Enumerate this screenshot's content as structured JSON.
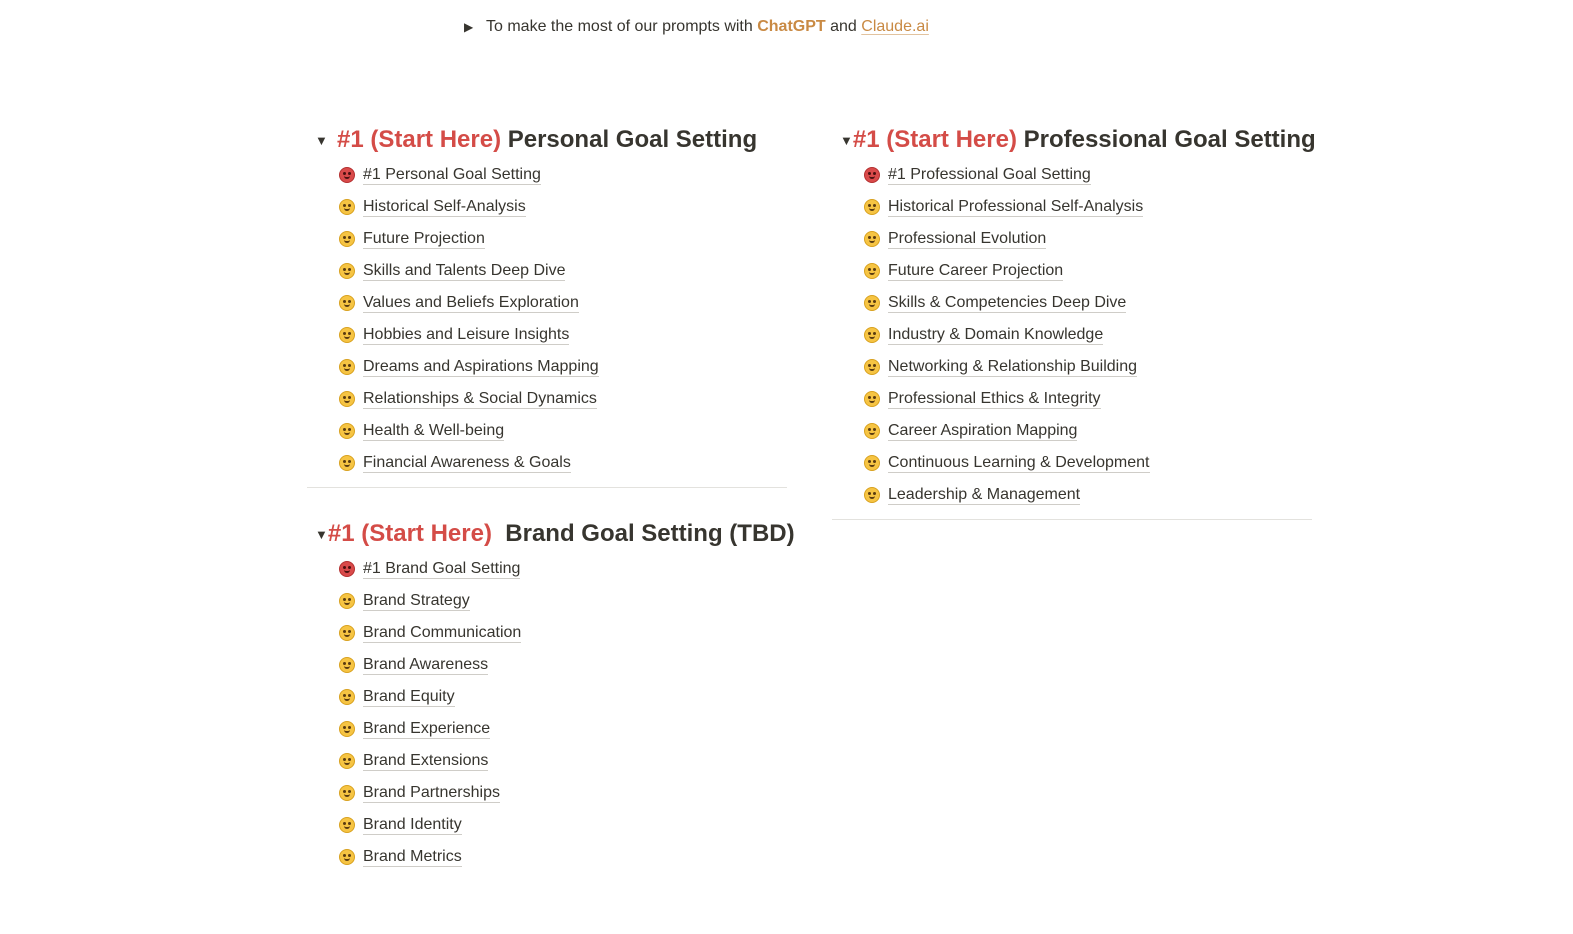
{
  "intro": {
    "text_before": "To make the most of our prompts with ",
    "chatgpt": "ChatGPT",
    "and": " and ",
    "claude": "Claude.ai"
  },
  "sections": {
    "personal": {
      "title_prefix": "#1 (Start Here)",
      "title_main": " Personal Goal Setting",
      "items": [
        {
          "label": "#1 Personal Goal Setting",
          "icon": "wink-emoji-icon"
        },
        {
          "label": "Historical Self-Analysis",
          "icon": "grin-emoji-icon"
        },
        {
          "label": "Future Projection",
          "icon": "grin-emoji-icon"
        },
        {
          "label": "Skills and Talents Deep Dive",
          "icon": "grin-emoji-icon"
        },
        {
          "label": "Values and Beliefs Exploration",
          "icon": "grin-emoji-icon"
        },
        {
          "label": "Hobbies and Leisure Insights",
          "icon": "grin-emoji-icon"
        },
        {
          "label": "Dreams and Aspirations Mapping",
          "icon": "grin-emoji-icon"
        },
        {
          "label": "Relationships & Social Dynamics",
          "icon": "grin-emoji-icon"
        },
        {
          "label": "Health & Well-being",
          "icon": "grin-emoji-icon"
        },
        {
          "label": "Financial Awareness & Goals",
          "icon": "grin-emoji-icon"
        }
      ]
    },
    "professional": {
      "title_prefix": "#1 (Start Here)",
      "title_main": " Professional Goal Setting",
      "items": [
        {
          "label": "#1 Professional Goal Setting",
          "icon": "wink-emoji-icon"
        },
        {
          "label": "Historical Professional Self-Analysis",
          "icon": "grin-emoji-icon"
        },
        {
          "label": "Professional Evolution",
          "icon": "grin-emoji-icon"
        },
        {
          "label": "Future Career Projection",
          "icon": "grin-emoji-icon"
        },
        {
          "label": "Skills & Competencies Deep Dive",
          "icon": "grin-emoji-icon"
        },
        {
          "label": "Industry & Domain Knowledge",
          "icon": "grin-emoji-icon"
        },
        {
          "label": "Networking & Relationship Building",
          "icon": "grin-emoji-icon"
        },
        {
          "label": "Professional Ethics & Integrity",
          "icon": "grin-emoji-icon"
        },
        {
          "label": "Career Aspiration Mapping",
          "icon": "grin-emoji-icon"
        },
        {
          "label": "Continuous Learning & Development",
          "icon": "grin-emoji-icon"
        },
        {
          "label": "Leadership & Management",
          "icon": "grin-emoji-icon"
        }
      ]
    },
    "brand": {
      "title_prefix": "#1 (Start Here)",
      "title_main": "  Brand Goal Setting (TBD)",
      "items": [
        {
          "label": "#1 Brand Goal Setting",
          "icon": "wink-emoji-icon"
        },
        {
          "label": "Brand Strategy",
          "icon": "grin-emoji-icon"
        },
        {
          "label": "Brand Communication",
          "icon": "grin-emoji-icon"
        },
        {
          "label": "Brand Awareness",
          "icon": "grin-emoji-icon"
        },
        {
          "label": "Brand Equity",
          "icon": "grin-emoji-icon"
        },
        {
          "label": "Brand Experience",
          "icon": "grin-emoji-icon"
        },
        {
          "label": "Brand Extensions",
          "icon": "grin-emoji-icon"
        },
        {
          "label": "Brand Partnerships",
          "icon": "grin-emoji-icon"
        },
        {
          "label": "Brand Identity",
          "icon": "grin-emoji-icon"
        },
        {
          "label": "Brand Metrics",
          "icon": "grin-emoji-icon"
        }
      ]
    }
  },
  "colors": {
    "accent_red": "#d44c47",
    "accent_orange": "#c98a44",
    "text": "#37352f"
  }
}
